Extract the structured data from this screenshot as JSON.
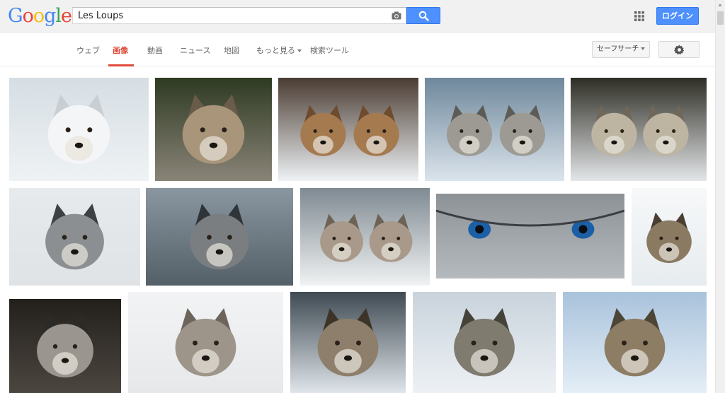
{
  "header": {
    "logo_letters": [
      {
        "ch": "G",
        "color": "#4285f4"
      },
      {
        "ch": "o",
        "color": "#ea4335"
      },
      {
        "ch": "o",
        "color": "#fbbc05"
      },
      {
        "ch": "g",
        "color": "#4285f4"
      },
      {
        "ch": "l",
        "color": "#34a853"
      },
      {
        "ch": "e",
        "color": "#ea4335"
      }
    ],
    "search_query": "Les Loups",
    "login_label": "ログイン",
    "camera_icon": "camera-icon",
    "search_icon": "search-icon",
    "apps_icon": "apps-grid-icon"
  },
  "nav": {
    "tabs": [
      "ウェブ",
      "画像",
      "動画",
      "ニュース",
      "地図",
      "もっと見る",
      "検索ツール"
    ],
    "active_tab": "画像",
    "safesearch_label": "セーフサーチ",
    "settings_icon": "gear-icon"
  },
  "results": {
    "accent": "#dd4b39",
    "images": [
      {
        "scene": "white",
        "bg": "#dfe6ea"
      },
      {
        "scene": "rocks",
        "bg": "#3c4a2c"
      },
      {
        "scene": "snow-pack",
        "bg": "#5a4a3e"
      },
      {
        "scene": "pair-nose",
        "bg": "#8ea3b5"
      },
      {
        "scene": "pair-dark",
        "bg": "#3d3b30"
      },
      {
        "scene": "portrait",
        "bg": "#e4e8ea"
      },
      {
        "scene": "trees",
        "bg": "#6b7a88"
      },
      {
        "scene": "pack-snow",
        "bg": "#d8dde0"
      },
      {
        "scene": "eyes",
        "bg": "#9aa0a4"
      },
      {
        "scene": "art",
        "bg": "#f4f6f7"
      },
      {
        "scene": "snarl",
        "bg": "#2a2622"
      },
      {
        "scene": "white-field",
        "bg": "#eef0f1"
      },
      {
        "scene": "forest",
        "bg": "#4e5a62"
      },
      {
        "scene": "lying",
        "bg": "#cfd8e2"
      },
      {
        "scene": "blue-snow",
        "bg": "#bcd3e6"
      }
    ]
  }
}
